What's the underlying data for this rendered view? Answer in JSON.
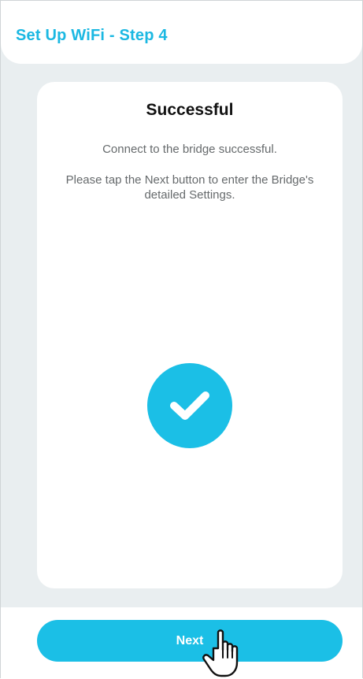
{
  "header": {
    "title": "Set Up WiFi - Step 4"
  },
  "card": {
    "title": "Successful",
    "message": "Connect to the bridge successful.",
    "instruction": "Please tap the Next button to enter the Bridge's detailed Settings.",
    "status_icon": "check-circle-icon"
  },
  "footer": {
    "next_label": "Next"
  },
  "cursor": {
    "icon": "hand-pointer-icon"
  },
  "colors": {
    "accent": "#1bbfe6",
    "title_accent": "#1bb8e2",
    "background": "#e9eef0",
    "card": "#ffffff",
    "body_text": "#666a6c"
  }
}
